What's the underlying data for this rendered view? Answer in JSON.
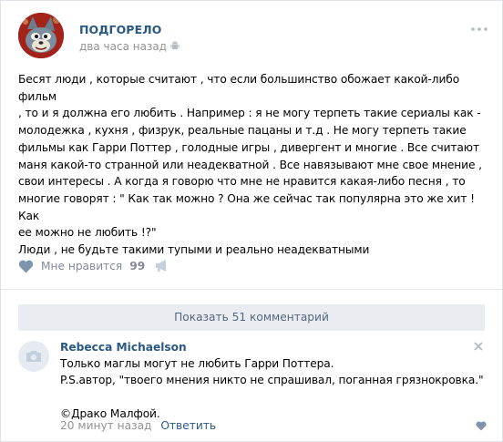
{
  "post": {
    "author": "ПОДГОРЕЛО",
    "time": "два часа назад",
    "platform_icon": "android-icon",
    "text": "Бесят люди , которые считают , что если большинство обожает какой-либо фильм\n, то и я должна его любить . Например : я не могу терпеть такие сериалы как -\nмолодежка , кухня , физрук, реальные пацаны и т.д . Не могу терпеть такие\nфильмы как Гарри Поттер , голодные игры , дивергент и многие . Все считают\nманя какой-то странной или неадекватной . Все навязывают мне свое мнение ,\nсвои интересы . А когда я говорю что мне не нравится какая-либо песня , то\nмногие говорят : \" Как так можно ? Она же сейчас так популярна это же хит ! Как\nее можно не любить !?\"\nЛюди , не будьте такими тупыми и реально неадекватными",
    "like_label": "Мне нравится",
    "like_count": "99"
  },
  "comments_bar": {
    "label": "Показать 51 комментарий"
  },
  "comment": {
    "author": "Rebecca Michaelson",
    "text": "Только маглы могут не любить Гарри Поттера.\nP.S.автор, \"твоего мнения никто не спрашивал, поганная грязнокровка.\"\n\n©Драко Малфой.",
    "time": "20 минут назад",
    "reply_label": "Ответить"
  },
  "colors": {
    "link": "#2a5885",
    "muted": "#939393",
    "action": "#828a99",
    "button_bg": "#e9ecf0"
  }
}
